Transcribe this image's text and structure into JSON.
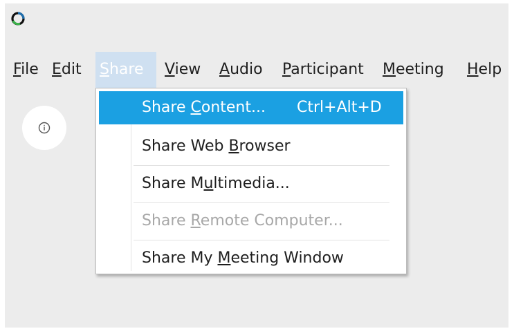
{
  "app": {
    "logo_icon": "circle-logo-icon",
    "brand_colors": [
      "#1f6fae",
      "#3bb24a",
      "#111111"
    ]
  },
  "menubar": {
    "items": [
      {
        "pre": "",
        "acc": "F",
        "post": "ile"
      },
      {
        "pre": "",
        "acc": "E",
        "post": "dit"
      },
      {
        "pre": "",
        "acc": "S",
        "post": "hare"
      },
      {
        "pre": "",
        "acc": "V",
        "post": "iew"
      },
      {
        "pre": "",
        "acc": "A",
        "post": "udio"
      },
      {
        "pre": "",
        "acc": "P",
        "post": "articipant"
      },
      {
        "pre": "",
        "acc": "M",
        "post": "eeting"
      },
      {
        "pre": "",
        "acc": "H",
        "post": "elp"
      }
    ]
  },
  "info_button": {
    "icon": "info-icon"
  },
  "share_menu": {
    "items": [
      {
        "pre": "Share ",
        "acc": "C",
        "post": "ontent...",
        "shortcut": "Ctrl+Alt+D",
        "state": "highlighted"
      },
      {
        "pre": "Share Web ",
        "acc": "B",
        "post": "rowser",
        "shortcut": "",
        "state": "normal"
      },
      {
        "pre": "Share M",
        "acc": "u",
        "post": "ltimedia...",
        "shortcut": "",
        "state": "normal"
      },
      {
        "pre": "Share ",
        "acc": "R",
        "post": "emote Computer...",
        "shortcut": "",
        "state": "disabled"
      },
      {
        "pre": "Share My ",
        "acc": "M",
        "post": "eeting Window",
        "shortcut": "",
        "state": "normal"
      }
    ]
  },
  "colors": {
    "highlight": "#1ba0e2",
    "active_menu": "#cfe0f1",
    "disabled_text": "#a8a8a8"
  }
}
